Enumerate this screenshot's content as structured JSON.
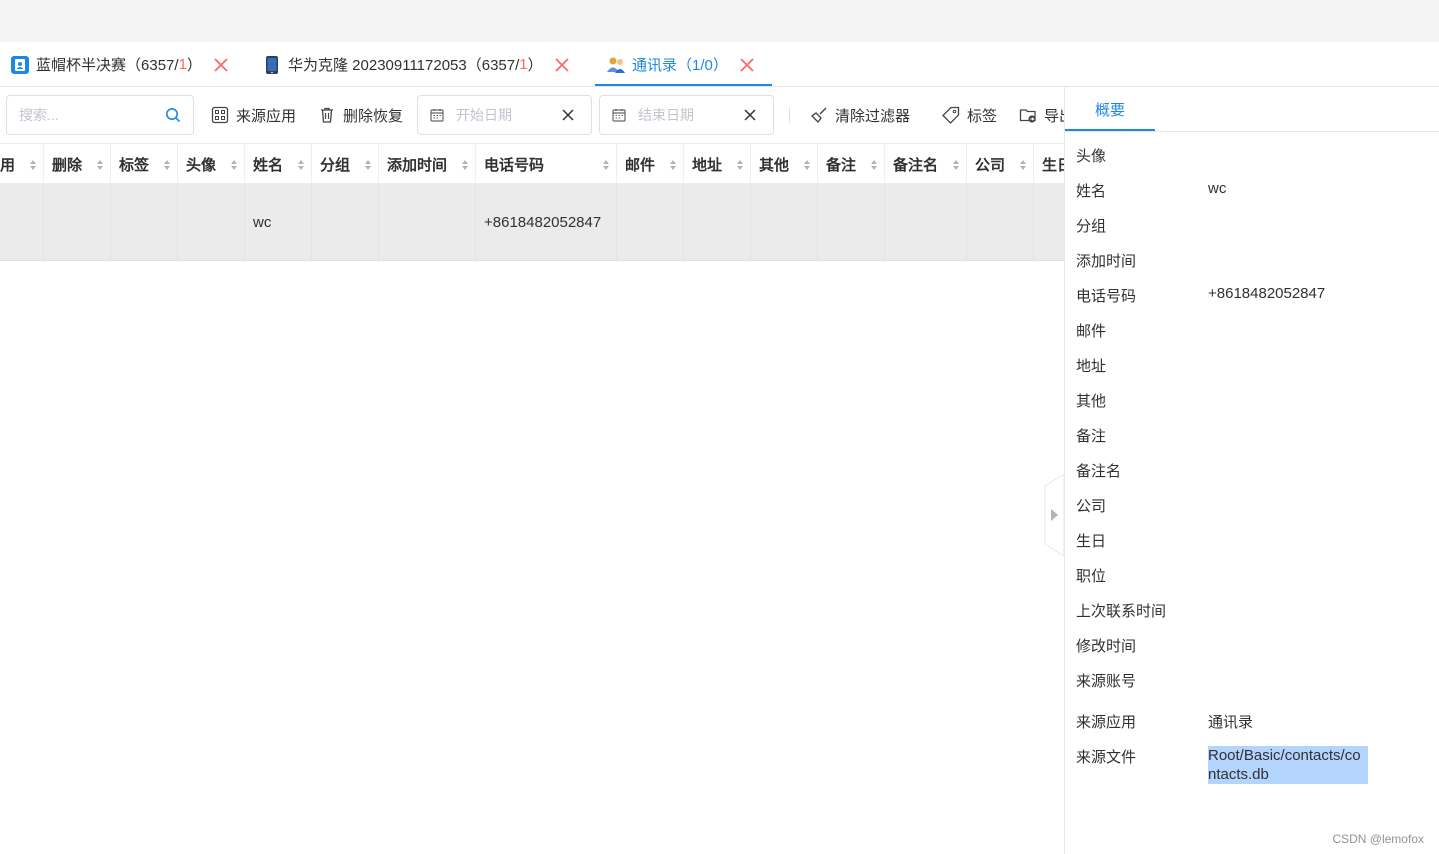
{
  "tabs": [
    {
      "icon": "contact-app-icon",
      "label": "蓝帽杯半决赛",
      "count": "（6357/",
      "new": "1",
      "end": "）"
    },
    {
      "icon": "phone-icon",
      "label": "华为克隆 20230911172053",
      "count": "（6357/",
      "new": "1",
      "end": "）"
    },
    {
      "icon": "contacts-people-icon",
      "label": "通讯录",
      "count": "（1/0）",
      "new": "",
      "end": ""
    }
  ],
  "toolbar": {
    "search_placeholder": "搜索...",
    "source_app": "来源应用",
    "delete_restore": "删除恢复",
    "start_date": "开始日期",
    "end_date": "结束日期",
    "clear_filter": "清除过滤器",
    "tag": "标签",
    "export": "导出"
  },
  "table": {
    "headers": [
      "用",
      "删除",
      "标签",
      "头像",
      "姓名",
      "分组",
      "添加时间",
      "电话号码",
      "邮件",
      "地址",
      "其他",
      "备注",
      "备注名",
      "公司",
      "生日"
    ],
    "row": {
      "name": "wc",
      "phone": "+8618482052847"
    }
  },
  "panel": {
    "tab": "概要",
    "fields": [
      {
        "label": "头像",
        "value": ""
      },
      {
        "label": "姓名",
        "value": "wc"
      },
      {
        "label": "分组",
        "value": ""
      },
      {
        "label": "添加时间",
        "value": ""
      },
      {
        "label": "电话号码",
        "value": "+8618482052847"
      },
      {
        "label": "邮件",
        "value": ""
      },
      {
        "label": "地址",
        "value": ""
      },
      {
        "label": "其他",
        "value": ""
      },
      {
        "label": "备注",
        "value": ""
      },
      {
        "label": "备注名",
        "value": ""
      },
      {
        "label": "公司",
        "value": ""
      },
      {
        "label": "生日",
        "value": ""
      },
      {
        "label": "职位",
        "value": ""
      },
      {
        "label": "上次联系时间",
        "value": ""
      },
      {
        "label": "修改时间",
        "value": ""
      },
      {
        "label": "来源账号",
        "value": ""
      },
      {
        "label": "来源应用",
        "value": "通讯录"
      },
      {
        "label": "来源文件",
        "value": "Root/Basic/contacts/contacts.db"
      }
    ]
  },
  "watermark": "CSDN @lemofox",
  "colors": {
    "accent": "#1e88e5",
    "danger": "#f56c6c",
    "row_bg": "#ebebeb",
    "highlight": "#b3d4fc"
  }
}
